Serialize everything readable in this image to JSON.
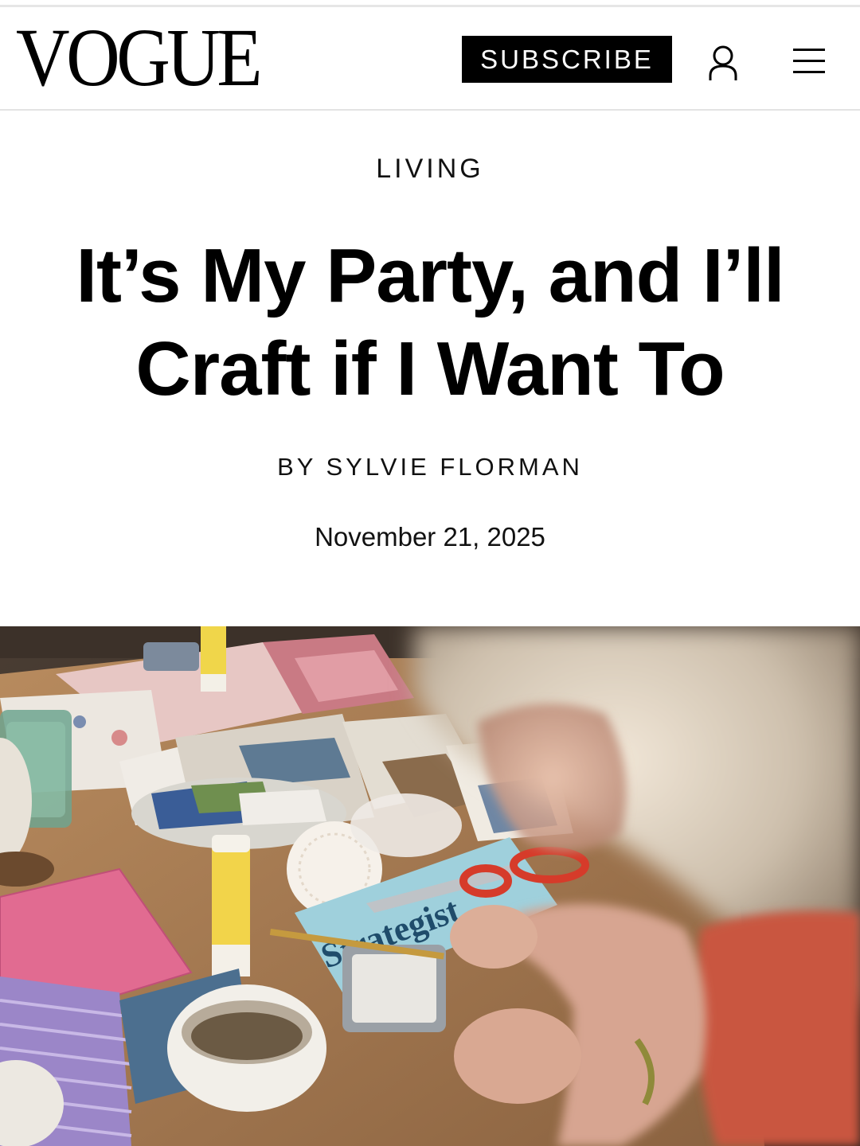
{
  "header": {
    "logo": "VOGUE",
    "subscribe_label": "SUBSCRIBE",
    "account_icon": "user-icon",
    "menu_icon": "hamburger-menu-icon"
  },
  "article": {
    "section": "LIVING",
    "headline": "It’s My Party, and I’ll Craft if I Want To",
    "byline": "BY SYLVIE FLORMAN",
    "date": "November 21, 2025"
  },
  "hero_image": {
    "magazine_text": "Strategist"
  },
  "colors": {
    "brand": "#000000",
    "background": "#ffffff",
    "divider": "#e3e3e3"
  }
}
